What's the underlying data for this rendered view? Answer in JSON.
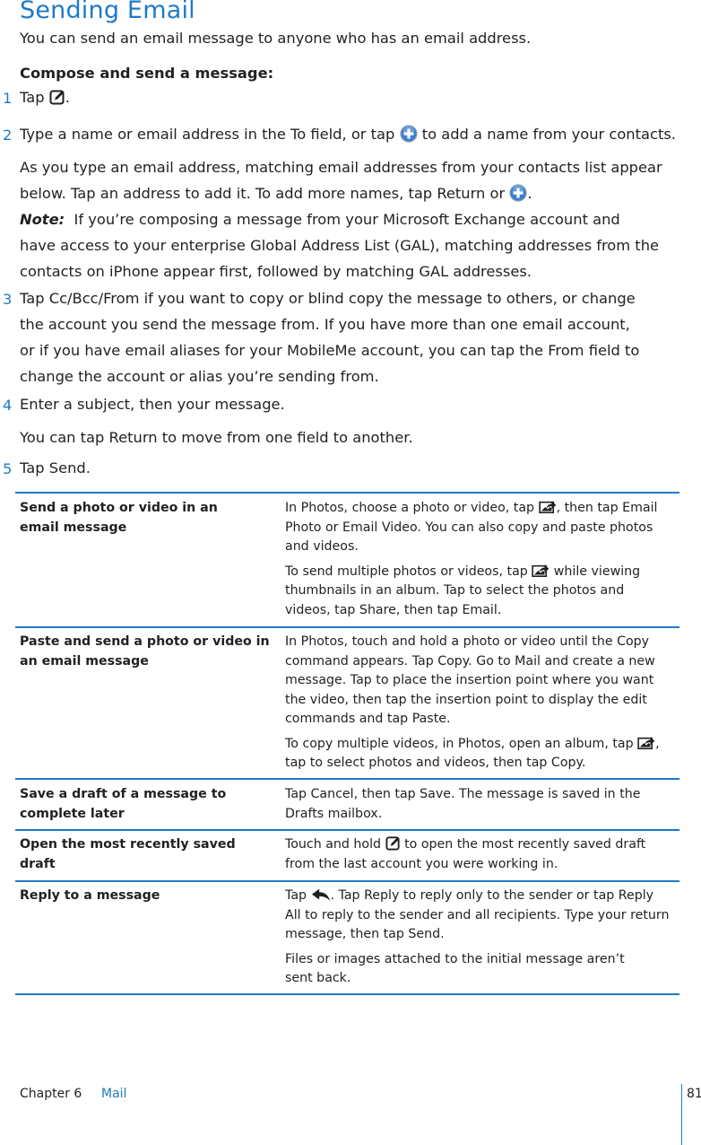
{
  "page": {
    "title": "Sending Email",
    "intro": "You can send an email message to anyone who has an email address.",
    "subhead": "Compose and send a message:"
  },
  "steps": [
    {
      "num": "1",
      "before": "Tap ",
      "icon": "compose-icon",
      "after": "."
    },
    {
      "num": "2",
      "before": "Type a name or email address in the To field, or tap ",
      "icon": "add-contact-icon",
      "after": " to add a name from your contacts."
    },
    {
      "num": "3",
      "lines": [
        "Tap Cc/Bcc/From if you want to copy or blind copy the message to others, or change",
        "the account you send the message from. If you have more than one email account,",
        "or if you have email aliases for your MobileMe account, you can tap the From field to",
        "change the account or alias you’re sending from."
      ]
    },
    {
      "num": "4",
      "text": "Enter a subject, then your message."
    },
    {
      "num": "5",
      "text": "Tap Send."
    }
  ],
  "step2_detail": {
    "line1": "As you type an email address, matching email addresses from your contacts list appear",
    "line2_before": "below. Tap an address to add it. To add more names, tap Return or ",
    "line2_icon": "add-contact-icon",
    "line2_after": "."
  },
  "note": {
    "label": "Note:",
    "line1": "If you’re composing a message from your Microsoft Exchange account and",
    "line2": "have access to your enterprise Global Address List (GAL), matching addresses from the",
    "line3": "contacts on iPhone appear first, followed by matching GAL addresses."
  },
  "step4_detail": "You can tap Return to move from one field to another.",
  "table": {
    "rows": [
      {
        "task_lines": [
          "Send a photo or video in an",
          "email message"
        ],
        "p1_l1_before": "In Photos, choose a photo or video, tap ",
        "p1_l1_icon": "action-icon",
        "p1_l1_after": ", then tap Email",
        "p1_l2": "Photo or Email Video. You can also copy and paste photos",
        "p1_l3": "and videos.",
        "p2_l1_before": "To send multiple photos or videos, tap ",
        "p2_l1_icon": "action-icon",
        "p2_l1_after": " while viewing",
        "p2_l2": "thumbnails in an album. Tap to select the photos and",
        "p2_l3": "videos, tap Share, then tap Email."
      },
      {
        "task_lines": [
          "Paste and send a photo or video in",
          "an email message"
        ],
        "p1_lines": [
          "In Photos, touch and hold a photo or video until the Copy",
          "command appears. Tap Copy. Go to Mail and create a new",
          "message. Tap to place the insertion point where you want",
          "the video, then tap the insertion point to display the edit",
          "commands and tap Paste."
        ],
        "p2_l1_before": "To copy multiple videos, in Photos, open an album, tap ",
        "p2_l1_icon": "action-icon",
        "p2_l1_after": ",",
        "p2_l2": "tap to select photos and videos, then tap Copy."
      },
      {
        "task_lines": [
          "Save a draft of a message to",
          "complete later"
        ],
        "p1_lines": [
          "Tap Cancel, then tap Save. The message is saved in the",
          "Drafts mailbox."
        ]
      },
      {
        "task_lines": [
          "Open the most recently saved draft"
        ],
        "p1_l1_before": "Touch and hold ",
        "p1_l1_icon": "compose-icon",
        "p1_l1_after": " to open the most recently saved draft",
        "p1_l2": "from the last account you were working in."
      },
      {
        "task_lines": [
          "Reply to a message"
        ],
        "p1_l1_before": "Tap ",
        "p1_l1_icon": "reply-icon",
        "p1_l1_after": ". Tap Reply to reply only to the sender or tap Reply",
        "p1_l2": "All to reply to the sender and all recipients. Type your return",
        "p1_l3": "message, then tap Send.",
        "p2_lines": [
          "Files or images attached to the initial message aren’t",
          "sent back."
        ]
      }
    ]
  },
  "footer": {
    "chapter": "Chapter 6",
    "section": "Mail",
    "page_number": "81"
  },
  "colors": {
    "accent": "#1d7ac8",
    "text": "#231f20"
  }
}
